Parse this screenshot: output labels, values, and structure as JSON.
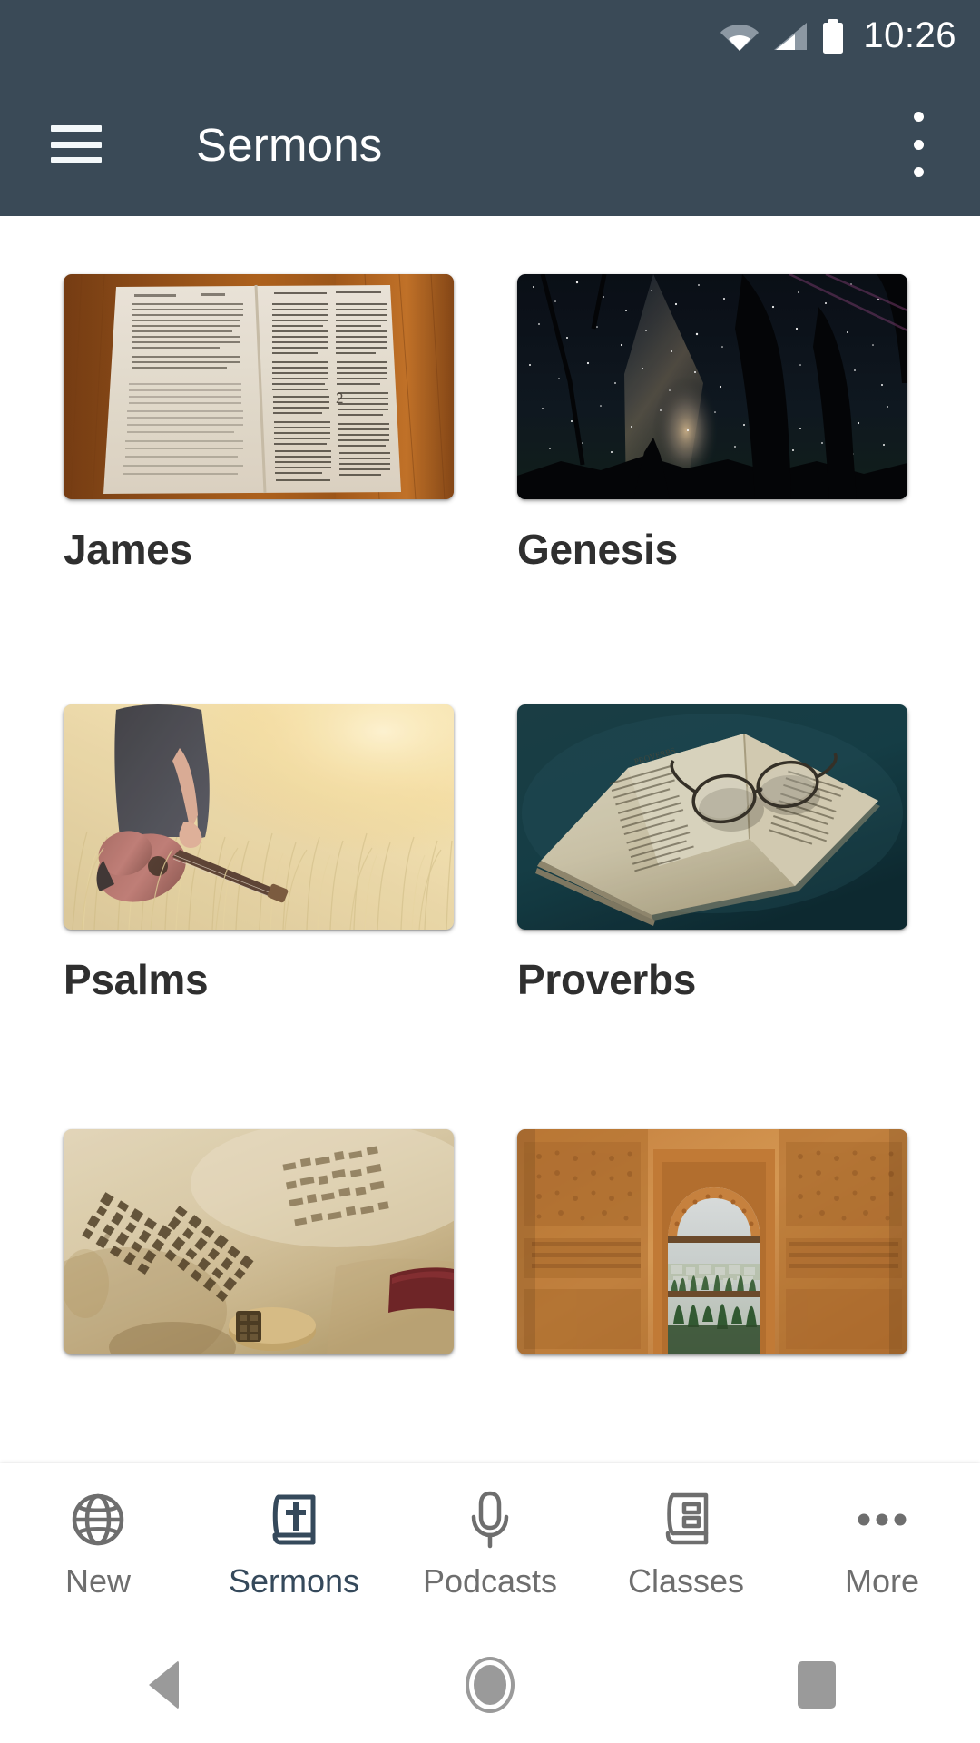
{
  "status_bar": {
    "time": "10:26",
    "icons": [
      "wifi-icon",
      "cell-signal-icon",
      "battery-icon"
    ]
  },
  "app_bar": {
    "menu_icon": "hamburger-menu-icon",
    "title": "Sermons",
    "overflow_icon": "overflow-menu-icon",
    "background_color": "#3a4a57",
    "text_color": "#ffffff"
  },
  "content": {
    "cards": [
      {
        "label": "James",
        "image": "open-bible-on-wooden-table"
      },
      {
        "label": "Genesis",
        "image": "milky-way-night-sky-with-trees"
      },
      {
        "label": "Psalms",
        "image": "person-holding-guitar-in-golden-field"
      },
      {
        "label": "Proverbs",
        "image": "open-book-with-eyeglasses-dark-teal"
      },
      {
        "label": "",
        "image": "hebrew-scroll-manuscript"
      },
      {
        "label": "",
        "image": "moorish-arch-window-overlooking-city"
      }
    ]
  },
  "bottom_nav": {
    "items": [
      {
        "label": "New",
        "icon": "globe-icon",
        "active": false
      },
      {
        "label": "Sermons",
        "icon": "bible-cross-icon",
        "active": true
      },
      {
        "label": "Podcasts",
        "icon": "microphone-icon",
        "active": false
      },
      {
        "label": "Classes",
        "icon": "book-icon",
        "active": false
      },
      {
        "label": "More",
        "icon": "ellipsis-icon",
        "active": false
      }
    ],
    "active_color": "#35495b",
    "inactive_color": "#6e6e6e"
  },
  "android_nav": {
    "back": "back-triangle-icon",
    "home": "home-circle-icon",
    "recents": "recents-square-icon"
  }
}
